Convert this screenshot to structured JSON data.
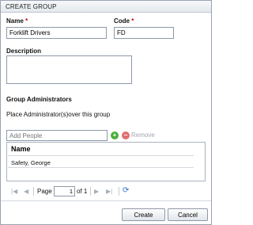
{
  "dialog": {
    "title": "CREATE GROUP"
  },
  "form": {
    "name_label": "Name",
    "name_value": "Forklift Drivers",
    "code_label": "Code",
    "code_value": "FD",
    "required_marker": "*",
    "description_label": "Description",
    "description_value": ""
  },
  "admins": {
    "heading": "Group Administrators",
    "instructions": "Place Administrator(s)over this group",
    "add_placeholder": "Add People",
    "remove_label": "Remove",
    "add_icon": "plus-circle-icon",
    "remove_icon": "minus-circle-icon",
    "add_color": "#4caf3a",
    "remove_color": "#e07070"
  },
  "grid": {
    "column_header": "Name",
    "rows": [
      "Safety, George"
    ]
  },
  "pager": {
    "page_label": "Page",
    "current_page": "1",
    "of_label": "of 1",
    "first_icon": "first-page-icon",
    "prev_icon": "prev-page-icon",
    "next_icon": "next-page-icon",
    "last_icon": "last-page-icon",
    "refresh_icon": "refresh-icon",
    "refresh_color": "#2f6fc7"
  },
  "buttons": {
    "create": "Create",
    "cancel": "Cancel"
  }
}
